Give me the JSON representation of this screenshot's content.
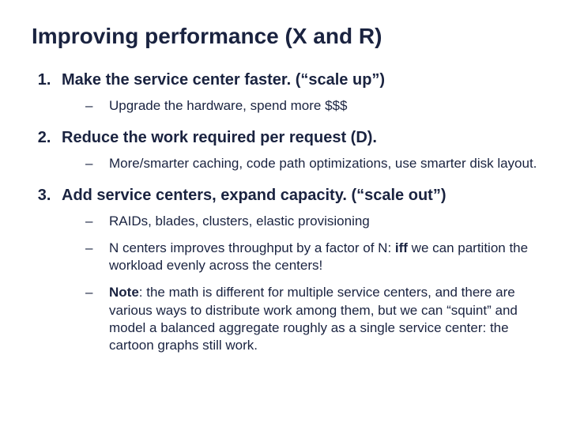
{
  "title": "Improving performance (X and R)",
  "items": [
    {
      "text": "Make the service center faster.  (“scale up”)",
      "subs": [
        {
          "text": "Upgrade the hardware, spend more $$$"
        }
      ]
    },
    {
      "text": "Reduce the work required per request (D).",
      "subs": [
        {
          "text": "More/smarter caching, code path optimizations, use smarter disk layout."
        }
      ]
    },
    {
      "text": "Add service centers, expand capacity.  (“scale out”)",
      "subs": [
        {
          "text": "RAIDs, blades, clusters, elastic provisioning"
        },
        {
          "prefix": "N centers improves throughput by a factor of N: ",
          "bold": "iff",
          "suffix": " we can partition the workload evenly across the centers!"
        },
        {
          "boldPrefix": "Note",
          "text": ": the math is different for multiple service centers, and there are various ways to distribute work among them, but we can “squint” and model a balanced aggregate roughly as a single service center: the cartoon graphs still work."
        }
      ]
    }
  ]
}
